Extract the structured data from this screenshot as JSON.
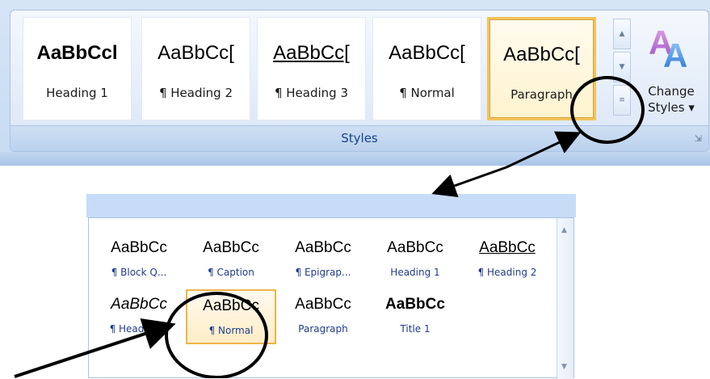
{
  "ribbon": {
    "tiles": [
      {
        "sample": "AaBbCcl",
        "name": "Heading 1"
      },
      {
        "sample": "AaBbCc[",
        "name": "¶ Heading 2"
      },
      {
        "sample": "AaBbCc[",
        "name": "¶ Heading 3"
      },
      {
        "sample": "AaBbCc[",
        "name": "¶ Normal"
      },
      {
        "sample": "AaBbCc[",
        "name": "Paragraph"
      }
    ],
    "group_label": "Styles",
    "change_styles_label": "Change Styles",
    "change_styles_line1": "Change",
    "change_styles_line2": "Styles ▾",
    "launcher_icon": "dialog-launcher-icon"
  },
  "gallery": {
    "row1": [
      {
        "sample": "AaBbCc",
        "name": "¶ Block Q..."
      },
      {
        "sample": "AaBbCc",
        "name": "¶ Caption"
      },
      {
        "sample": "AaBbCc",
        "name": "¶ Epigrap..."
      },
      {
        "sample": "AaBbCc",
        "name": "Heading 1"
      },
      {
        "sample": "AaBbCc",
        "name": "¶ Heading 2"
      }
    ],
    "row2": [
      {
        "sample": "AaBbCc",
        "name": "¶ Heading 3"
      },
      {
        "sample": "AaBbCc",
        "name": "¶ Normal"
      },
      {
        "sample": "AaBbCc",
        "name": "Paragraph"
      },
      {
        "sample": "AaBbCc",
        "name": "Title 1"
      }
    ]
  },
  "colors": {
    "accent_selected": "#f2c35b",
    "ribbon_blue": "#c7dbf2",
    "label_blue": "#15428b"
  }
}
